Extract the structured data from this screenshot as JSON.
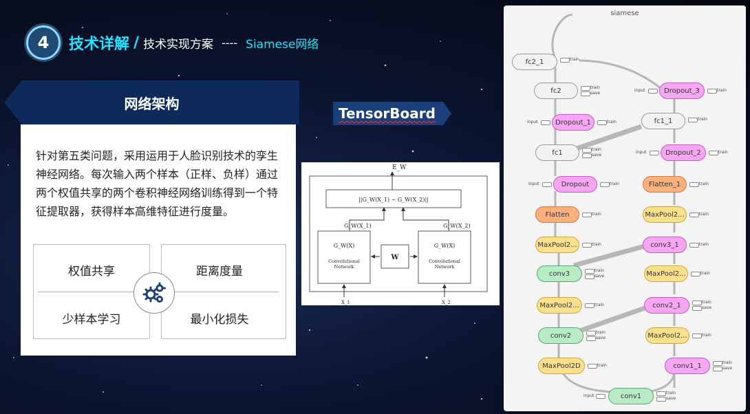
{
  "header": {
    "number": "4",
    "title": "技术详解",
    "slash": "/",
    "subtitle": "技术实现方案",
    "separator": "----",
    "topic": "Siamese网络"
  },
  "architecture": {
    "banner": "网络架构",
    "description": "针对第五类问题，采用运用于人脸识别技术的孪生神经网络。每次输入两个样本（正样、负样）通过两个权值共享的两个卷积神经网络训练得到一个特征提取器，获得样本高维特征进行度量。",
    "features": [
      "权值共享",
      "距离度量",
      "少样本学习",
      "最小化损失"
    ],
    "center_icon": "gears-icon"
  },
  "tensorboard": {
    "label": "TensorBoard"
  },
  "diagram": {
    "output": "E_W",
    "distance": "||G_W(X_1) − G_W(X_2)||",
    "left_feature": "G_W(X_1)",
    "right_feature": "G_W(X_2)",
    "left_net_fn": "G_W(X)",
    "right_net_fn": "G_W(X)",
    "net_label_1": "Convolutional",
    "net_label_2": "Network",
    "weights": "W",
    "input_1": "X_1",
    "input_2": "X_2"
  },
  "graph": {
    "title": "siamese",
    "tag_train": "train",
    "tag_save": "save",
    "tag_input": "input",
    "nodes": {
      "fc2_1": "fc2_1",
      "fc2": "fc2",
      "dropout_3": "Dropout_3",
      "dropout_1": "Dropout_1",
      "fc1_1": "fc1_1",
      "fc1": "fc1",
      "dropout_2": "Dropout_2",
      "dropout": "Dropout",
      "flatten_1": "Flatten_1",
      "flatten": "Flatten",
      "maxpool2_r1": "MaxPool2...",
      "maxpool2_l1": "MaxPool2...",
      "conv3_1": "conv3_1",
      "conv3": "conv3",
      "maxpool2_r2": "MaxPool2...",
      "maxpool2_l2": "MaxPool2...",
      "conv2_1": "conv2_1",
      "conv2": "conv2",
      "maxpool2_r3": "MaxPool2...",
      "maxpool2d": "MaxPool2D",
      "conv1_1": "conv1_1",
      "conv1": "conv1"
    }
  }
}
